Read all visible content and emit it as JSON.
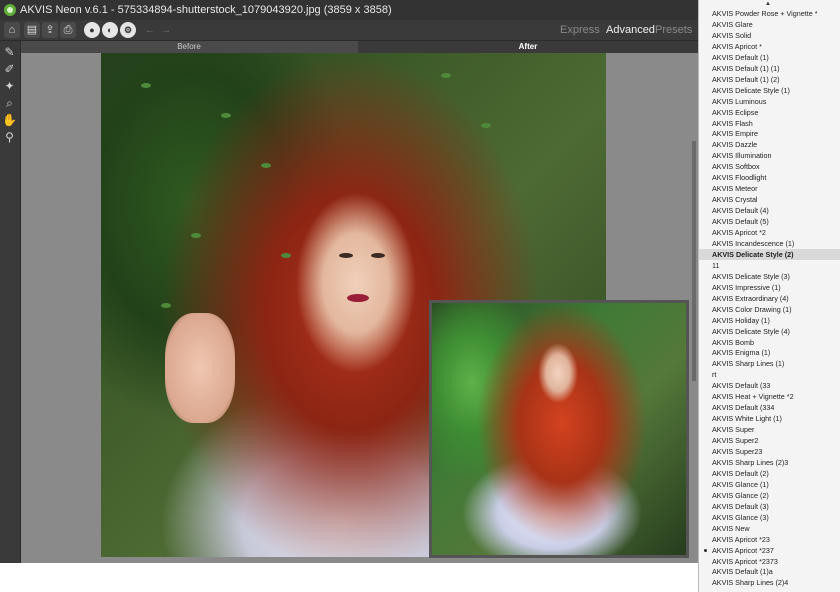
{
  "app": {
    "title": "AKVIS Neon v.6.1 - 575334894-shutterstock_1079043920.jpg (3859 x 3858)",
    "accent": "#5fae3a"
  },
  "toolbar": {
    "buttons": [
      {
        "name": "open-icon",
        "glyph": "⌂"
      },
      {
        "name": "save-icon",
        "glyph": "▤"
      },
      {
        "name": "export-icon",
        "glyph": "⇪"
      },
      {
        "name": "print-icon",
        "glyph": "⎙"
      },
      {
        "name": "run-icon",
        "glyph": "●"
      },
      {
        "name": "batch-icon",
        "glyph": "◐"
      },
      {
        "name": "settings-icon",
        "glyph": "⚙"
      },
      {
        "name": "undo-icon",
        "glyph": "←"
      },
      {
        "name": "redo-icon",
        "glyph": "→"
      }
    ],
    "modes": {
      "express": "Express",
      "advanced": "Advanced",
      "presets": "Presets"
    }
  },
  "left_tools": [
    {
      "name": "brush-tool-icon",
      "glyph": "✎"
    },
    {
      "name": "eraser-tool-icon",
      "glyph": "✐"
    },
    {
      "name": "dropper-tool-icon",
      "glyph": "✦"
    },
    {
      "name": "history-brush-icon",
      "glyph": "⌕"
    },
    {
      "name": "hand-tool-icon",
      "glyph": "✋"
    },
    {
      "name": "zoom-tool-icon",
      "glyph": "⚲"
    }
  ],
  "view_tabs": {
    "before": "Before",
    "after": "After"
  },
  "presets": {
    "items": [
      "AKVIS Powder Rose + Vignette *",
      "AKVIS Glare",
      "AKVIS Solid",
      "AKVIS Apricot *",
      "AKVIS Default (1)",
      "AKVIS Default (1) (1)",
      "AKVIS Default (1) (2)",
      "AKVIS Delicate Style (1)",
      "AKVIS Luminous",
      "AKVIS Eclipse",
      "AKVIS Flash",
      "AKVIS Empire",
      "AKVIS Dazzle",
      "AKVIS Illumination",
      "AKVIS Softbox",
      "AKVIS Floodlight",
      "AKVIS Meteor",
      "AKVIS Crystal",
      "AKVIS Default (4)",
      "AKVIS Default (5)",
      "AKVIS Apricot *2",
      "AKVIS Incandescence (1)",
      "AKVIS Delicate Style (2)",
      "11",
      "AKVIS Delicate Style (3)",
      "AKVIS Impressive (1)",
      "AKVIS Extraordinary (4)",
      "AKVIS Color Drawing (1)",
      "AKVIS Holiday (1)",
      "AKVIS Delicate Style (4)",
      "AKVIS Bomb",
      "AKVIS Enigma (1)",
      "AKVIS Sharp Lines (1)",
      "rt",
      "AKVIS Default (33",
      "AKVIS Heat + Vignette *2",
      "AKVIS Default (334",
      "AKVIS White Light (1)",
      "AKVIS Super",
      "AKVIS Super2",
      "AKVIS Super23",
      "AKVIS Sharp Lines (2)3",
      "AKVIS Default (2)",
      "AKVIS Glance (1)",
      "AKVIS Glance (2)",
      "AKVIS Default (3)",
      "AKVIS Glance (3)",
      "AKVIS New",
      "AKVIS Apricot *23",
      "AKVIS Apricot *237",
      "AKVIS Apricot *2373",
      "AKVIS Default (1)a",
      "AKVIS Sharp Lines (2)4"
    ],
    "selected": "AKVIS Delicate Style (2)",
    "marked": "AKVIS Apricot *237"
  }
}
